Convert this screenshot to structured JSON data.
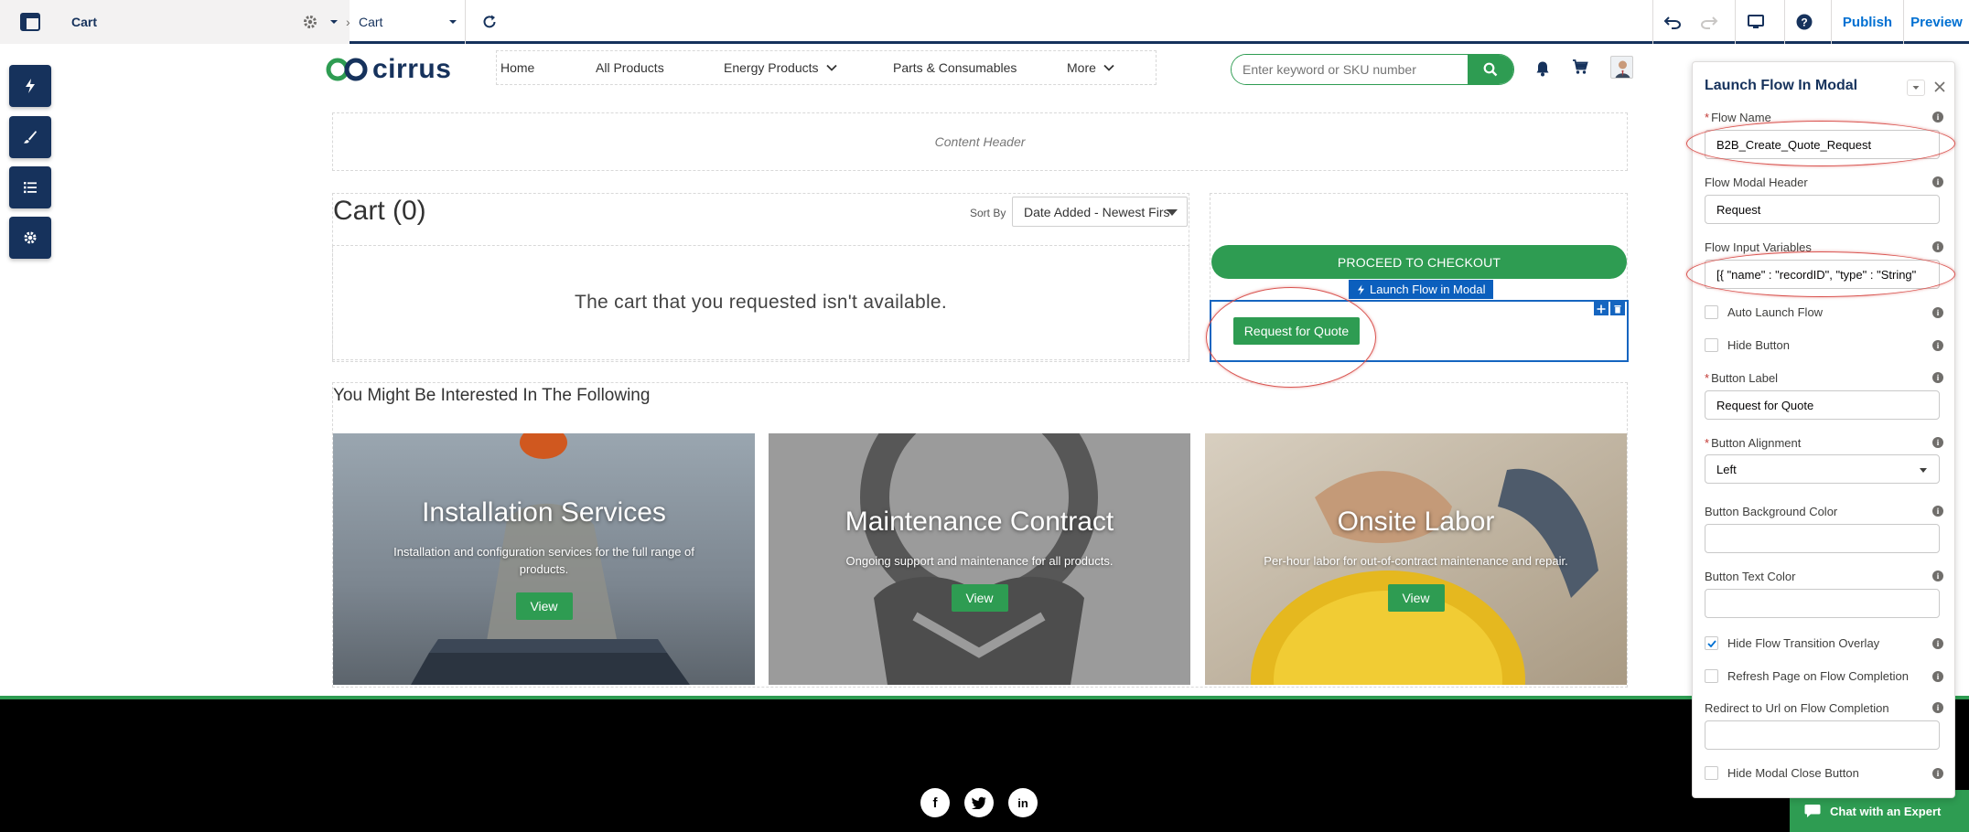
{
  "builder": {
    "page_selector": "Cart",
    "breadcrumb_page": "Cart",
    "publish_label": "Publish",
    "preview_label": "Preview"
  },
  "site": {
    "logo_text": "cirrus",
    "nav": [
      "Home",
      "All Products",
      "Energy Products",
      "Parts & Consumables",
      "More"
    ],
    "search_placeholder": "Enter keyword or SKU number",
    "content_header": "Content Header",
    "cart_title": "Cart (0)",
    "sort_label": "Sort By",
    "sort_value": "Date Added - Newest Firs",
    "empty_message": "The cart that you requested isn't available.",
    "checkout_label": "PROCEED TO CHECKOUT",
    "component_tag": "Launch Flow in Modal",
    "rfq_label": "Request for Quote",
    "interest_title": "You Might Be Interested In The Following",
    "cards": [
      {
        "title": "Installation Services",
        "text": "Installation and configuration services for the full range of products.",
        "button": "View"
      },
      {
        "title": "Maintenance Contract",
        "text": "Ongoing support and maintenance for all products.",
        "button": "View"
      },
      {
        "title": "Onsite Labor",
        "text": "Per-hour labor for out-of-contract maintenance and repair.",
        "button": "View"
      }
    ],
    "social": [
      "f",
      "twitter",
      "in"
    ],
    "chat_label": "Chat with an Expert"
  },
  "panel": {
    "title": "Launch Flow In Modal",
    "flow_name_label": "Flow Name",
    "flow_name_value": "B2B_Create_Quote_Request",
    "modal_header_label": "Flow Modal Header",
    "modal_header_value": "Request",
    "input_vars_label": "Flow Input Variables",
    "input_vars_value": "[{ \"name\" : \"recordID\", \"type\" : \"String\"",
    "auto_launch_label": "Auto Launch Flow",
    "hide_button_label": "Hide Button",
    "button_label_label": "Button Label",
    "button_label_value": "Request for Quote",
    "button_alignment_label": "Button Alignment",
    "button_alignment_value": "Left",
    "bg_color_label": "Button Background Color",
    "text_color_label": "Button Text Color",
    "hide_overlay_label": "Hide Flow Transition Overlay",
    "refresh_label": "Refresh Page on Flow Completion",
    "redirect_label": "Redirect to Url on Flow Completion",
    "hide_close_label": "Hide Modal Close Button",
    "checks": {
      "auto_launch": false,
      "hide_button": false,
      "hide_overlay": true,
      "refresh": false,
      "hide_close": false
    }
  },
  "colors": {
    "brand_green": "#2e9c52",
    "builder_navy": "#16325c",
    "selection_blue": "#1565c0",
    "annotation_red": "#d9534f"
  }
}
